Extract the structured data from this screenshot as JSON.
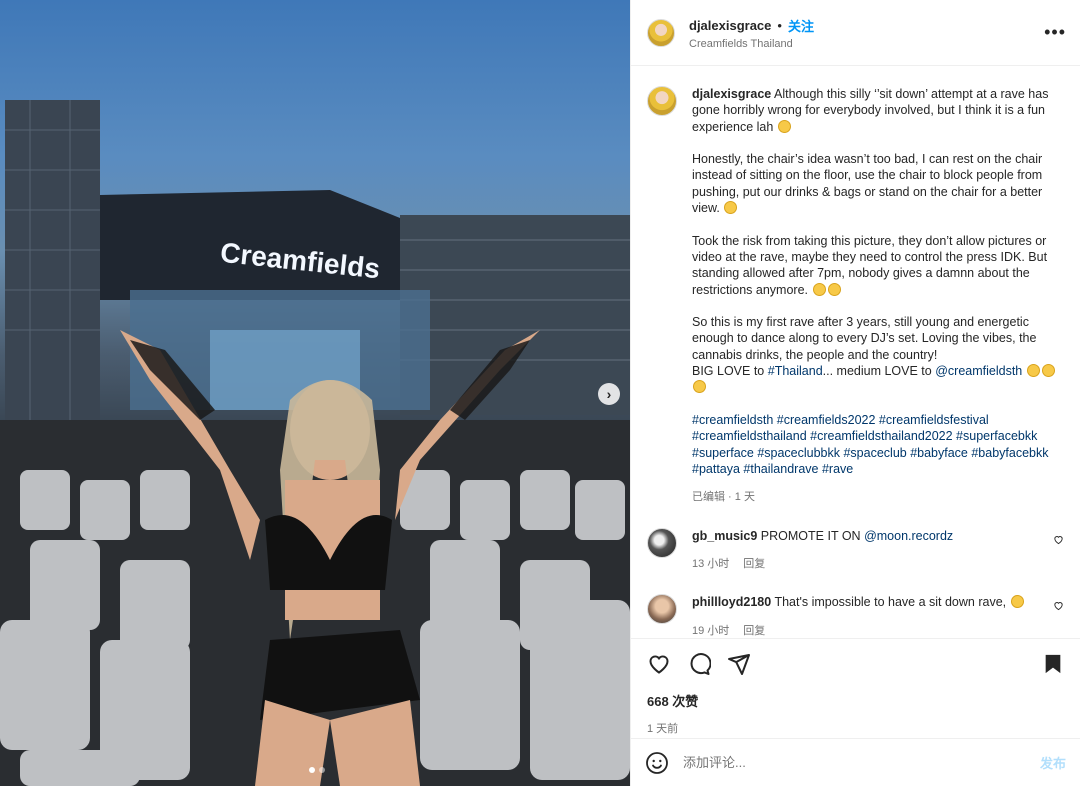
{
  "post": {
    "username": "djalexisgrace",
    "follow_label": "关注",
    "dot": "•",
    "location": "Creamfields Thailand",
    "more_label": "•••"
  },
  "media": {
    "stage_sign": "Creamfields",
    "next_label": "›",
    "slide_count": 2,
    "slide_current": 1
  },
  "caption": {
    "username": "djalexisgrace",
    "p1": "Although this silly ‘’sit down’ attempt at a rave has gone horribly wrong for everybody involved, but I think it is a fun experience lah",
    "p2": "Honestly, the chair’s idea wasn’t too bad, I can rest on the chair instead of sitting on the floor, use the chair to block people from pushing, put our drinks & bags or stand on the chair for a better view.",
    "p3": "Took the risk from taking this picture, they don’t allow pictures or video at the rave, maybe they need to control the press IDK. But standing allowed after 7pm, nobody gives a damnn about the restrictions anymore.",
    "p4a": "So this is my first rave after 3 years, still young and energetic enough to dance along to every DJ’s set. Loving the vibes, the cannabis drinks, the people and the country!",
    "p4b_pre": "BIG LOVE to",
    "p4b_tag": "#Thailand",
    "p4b_mid": "... medium LOVE to",
    "p4b_mention": "@creamfieldsth",
    "hashtags": "#creamfieldsth #creamfields2022 #creamfieldsfestival #creamfieldsthailand #creamfieldsthailand2022 #superfacebkk #superface #spaceclubbkk #spaceclub #babyface #babyfacebkk #pattaya #thailandrave #rave",
    "edited": "已编辑 · 1 天"
  },
  "comments": [
    {
      "username": "gb_music9",
      "text": "PROMOTE IT ON",
      "mention": "@moon.recordz",
      "time": "13 小时",
      "reply_label": "回复"
    },
    {
      "username": "phillloyd2180",
      "text": "That's impossible to have a sit down rave,",
      "time": "19 小时",
      "reply_label": "回复"
    }
  ],
  "stats": {
    "likes": "668 次赞",
    "time": "1 天前"
  },
  "composer": {
    "placeholder": "添加评论...",
    "post_label": "发布"
  },
  "colors": {
    "accent": "#0095f6",
    "link": "#00376b",
    "muted": "#737373",
    "post_disabled": "#b2dffc"
  }
}
